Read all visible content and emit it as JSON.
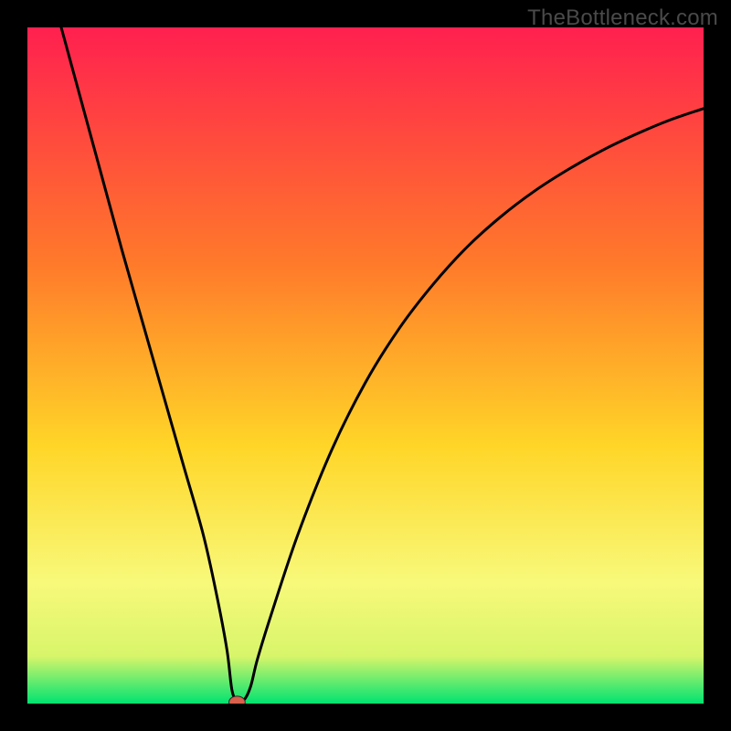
{
  "watermark": "TheBottleneck.com",
  "colors": {
    "frame_bg": "#000000",
    "grad_top": "#ff204f",
    "grad_mid1": "#ff7a2a",
    "grad_mid2": "#ffd628",
    "grad_mid3": "#f8f97a",
    "grad_mid4": "#d8f56a",
    "grad_bottom": "#00e371",
    "curve": "#000000",
    "marker_fill": "#d8604c",
    "marker_stroke": "#2a2a2a"
  },
  "chart_data": {
    "type": "line",
    "title": "",
    "xlabel": "",
    "ylabel": "",
    "xlim": [
      0,
      100
    ],
    "ylim": [
      0,
      100
    ],
    "series": [
      {
        "name": "bottleneck-curve",
        "x": [
          5,
          8,
          11,
          14,
          17,
          20,
          23,
          26,
          28,
          29.5,
          30.25,
          31,
          32,
          33,
          34,
          36,
          40,
          45,
          50,
          55,
          60,
          65,
          70,
          75,
          80,
          85,
          90,
          95,
          100
        ],
        "y": [
          100,
          89,
          78,
          67,
          56.5,
          46,
          35.5,
          25,
          16,
          8,
          2,
          0.5,
          0.5,
          2.5,
          6.5,
          13,
          25,
          37.5,
          47.5,
          55.5,
          62,
          67.5,
          72,
          75.8,
          79,
          81.8,
          84.2,
          86.3,
          88
        ]
      }
    ],
    "marker": {
      "x": 31,
      "y": 0.2,
      "rx": 1.2,
      "ry": 0.9
    },
    "flat_segment": {
      "x0": 30.2,
      "x1": 31.8,
      "y": 0.6
    }
  }
}
